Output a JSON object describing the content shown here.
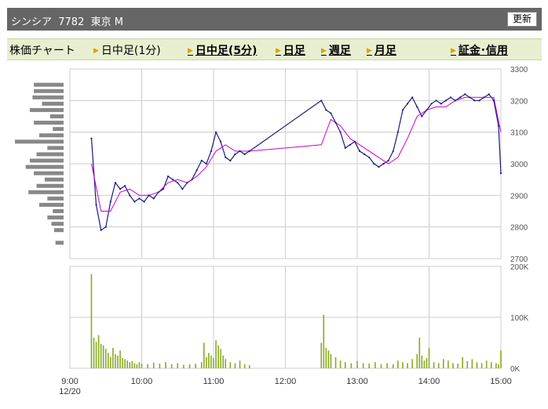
{
  "header": {
    "title": "シンシア  7782  東京 M",
    "refresh_label": "更新"
  },
  "tabs": [
    {
      "label": "株価チャート",
      "arrow": false,
      "link": false
    },
    {
      "label": "日中足(1分)",
      "arrow": true,
      "link": false
    },
    {
      "label": "日中足(5分)",
      "arrow": true,
      "link": true
    },
    {
      "label": "日足",
      "arrow": true,
      "link": true
    },
    {
      "label": "週足",
      "arrow": true,
      "link": true
    },
    {
      "label": "月足",
      "arrow": true,
      "link": true
    },
    {
      "label": "証金･信用",
      "arrow": true,
      "link": true
    }
  ],
  "colors": {
    "candle": "#1a1a80",
    "ma": "#cc00cc",
    "volume": "#8aaa20",
    "price_volume": "#888888",
    "grid": "#cccccc"
  },
  "chart_data": [
    {
      "type": "line",
      "title": "",
      "xlabel": "",
      "ylabel": "",
      "date_label": "12/20",
      "x_ticks": [
        "9:00",
        "10:00",
        "11:00",
        "12:00",
        "13:00",
        "14:00",
        "15:00"
      ],
      "y_ticks": [
        2700,
        2800,
        2900,
        3000,
        3100,
        3200,
        3300
      ],
      "ylim": [
        2700,
        3300
      ],
      "grid": true,
      "series": [
        {
          "x": [
            "9:18",
            "9:22",
            "9:26",
            "9:30",
            "9:34",
            "9:38",
            "9:42",
            "9:46",
            "9:50",
            "9:54",
            "9:58",
            "10:02",
            "10:06",
            "10:10",
            "10:14",
            "10:18",
            "10:22",
            "10:26",
            "10:30",
            "10:34",
            "10:38",
            "10:42",
            "10:46",
            "10:50",
            "10:54",
            "10:58",
            "11:02",
            "11:06",
            "11:10",
            "11:14",
            "11:18",
            "11:22",
            "11:26",
            "11:30",
            "12:30",
            "12:34",
            "12:38",
            "12:42",
            "12:46",
            "12:50",
            "12:54",
            "12:58",
            "13:02",
            "13:06",
            "13:10",
            "13:14",
            "13:18",
            "13:22",
            "13:26",
            "13:30",
            "13:34",
            "13:38",
            "13:42",
            "13:46",
            "13:50",
            "13:54",
            "13:58",
            "14:02",
            "14:06",
            "14:10",
            "14:14",
            "14:18",
            "14:22",
            "14:26",
            "14:30",
            "14:34",
            "14:38",
            "14:42",
            "14:46",
            "14:50",
            "14:54",
            "14:58",
            "15:00"
          ],
          "values": [
            3080,
            2870,
            2790,
            2800,
            2880,
            2940,
            2920,
            2930,
            2900,
            2880,
            2890,
            2880,
            2900,
            2890,
            2910,
            2920,
            2960,
            2950,
            2940,
            2920,
            2940,
            2950,
            2980,
            3010,
            3000,
            3040,
            3100,
            3070,
            3020,
            3010,
            3030,
            3040,
            3030,
            3040,
            3200,
            3170,
            3160,
            3130,
            3100,
            3050,
            3060,
            3070,
            3040,
            3030,
            3020,
            3000,
            2990,
            3000,
            3010,
            3040,
            3100,
            3170,
            3190,
            3210,
            3180,
            3150,
            3170,
            3190,
            3200,
            3190,
            3200,
            3210,
            3200,
            3210,
            3220,
            3210,
            3200,
            3200,
            3210,
            3220,
            3200,
            3120,
            2970
          ]
        },
        {
          "x": [
            "9:18",
            "9:26",
            "9:34",
            "9:42",
            "9:50",
            "9:58",
            "10:06",
            "10:14",
            "10:22",
            "10:30",
            "10:38",
            "10:46",
            "10:54",
            "11:02",
            "11:10",
            "11:18",
            "11:30",
            "12:30",
            "12:38",
            "12:46",
            "12:54",
            "13:02",
            "13:10",
            "13:18",
            "13:26",
            "13:34",
            "13:42",
            "13:50",
            "13:58",
            "14:06",
            "14:14",
            "14:22",
            "14:30",
            "14:38",
            "14:46",
            "14:54",
            "15:00"
          ],
          "values": [
            3000,
            2850,
            2850,
            2910,
            2920,
            2900,
            2900,
            2910,
            2940,
            2950,
            2940,
            2960,
            2990,
            3040,
            3060,
            3040,
            3040,
            3060,
            3140,
            3120,
            3080,
            3060,
            3040,
            3020,
            3000,
            3020,
            3080,
            3150,
            3170,
            3180,
            3180,
            3200,
            3210,
            3210,
            3210,
            3210,
            3100
          ]
        }
      ]
    },
    {
      "type": "bar",
      "title": "",
      "y_ticks": [
        "0K",
        "100K",
        "200K"
      ],
      "ylim": [
        0,
        200000
      ],
      "times": [
        "9:18",
        "9:20",
        "9:22",
        "9:24",
        "9:26",
        "9:28",
        "9:30",
        "9:32",
        "9:34",
        "9:36",
        "9:38",
        "9:40",
        "9:42",
        "9:44",
        "9:46",
        "9:48",
        "9:50",
        "9:52",
        "9:54",
        "9:56",
        "9:58",
        "10:00",
        "10:05",
        "10:10",
        "10:15",
        "10:20",
        "10:25",
        "10:30",
        "10:35",
        "10:40",
        "10:45",
        "10:50",
        "10:52",
        "10:54",
        "10:56",
        "10:58",
        "11:00",
        "11:02",
        "11:04",
        "11:06",
        "11:08",
        "11:10",
        "11:14",
        "11:18",
        "11:22",
        "11:26",
        "11:30",
        "12:30",
        "12:32",
        "12:34",
        "12:36",
        "12:38",
        "12:42",
        "12:46",
        "12:50",
        "12:55",
        "13:00",
        "13:05",
        "13:10",
        "13:15",
        "13:20",
        "13:25",
        "13:30",
        "13:34",
        "13:38",
        "13:42",
        "13:46",
        "13:50",
        "13:52",
        "13:54",
        "13:56",
        "13:58",
        "14:00",
        "14:04",
        "14:08",
        "14:12",
        "14:16",
        "14:20",
        "14:24",
        "14:28",
        "14:32",
        "14:36",
        "14:40",
        "14:44",
        "14:48",
        "14:52",
        "14:56",
        "14:58",
        "15:00"
      ],
      "values": [
        185000,
        60000,
        52000,
        65000,
        48000,
        45000,
        38000,
        30000,
        22000,
        40000,
        28000,
        25000,
        35000,
        20000,
        18000,
        15000,
        12000,
        14000,
        10000,
        8000,
        12000,
        9000,
        8000,
        11000,
        9000,
        12000,
        8000,
        10000,
        7000,
        8000,
        9000,
        12000,
        50000,
        22000,
        30000,
        25000,
        20000,
        55000,
        45000,
        38000,
        25000,
        18000,
        12000,
        10000,
        15000,
        8000,
        6000,
        50000,
        105000,
        40000,
        35000,
        28000,
        22000,
        15000,
        12000,
        10000,
        14000,
        10000,
        9000,
        12000,
        8000,
        10000,
        8000,
        15000,
        12000,
        10000,
        18000,
        28000,
        60000,
        25000,
        15000,
        20000,
        40000,
        12000,
        10000,
        18000,
        15000,
        10000,
        9000,
        22000,
        14000,
        18000,
        12000,
        10000,
        15000,
        12000,
        10000,
        8000,
        35000
      ]
    },
    {
      "type": "bar",
      "title": "",
      "orientation": "horizontal",
      "price_levels": [
        3250,
        3230,
        3210,
        3190,
        3170,
        3150,
        3130,
        3110,
        3090,
        3070,
        3050,
        3030,
        3010,
        2990,
        2970,
        2950,
        2930,
        2910,
        2890,
        2870,
        2850,
        2830,
        2810,
        2790,
        2750
      ],
      "values": [
        22,
        22,
        23,
        16,
        25,
        10,
        22,
        8,
        18,
        36,
        12,
        20,
        25,
        28,
        22,
        14,
        20,
        26,
        12,
        18,
        8,
        12,
        9,
        7,
        6
      ]
    }
  ]
}
